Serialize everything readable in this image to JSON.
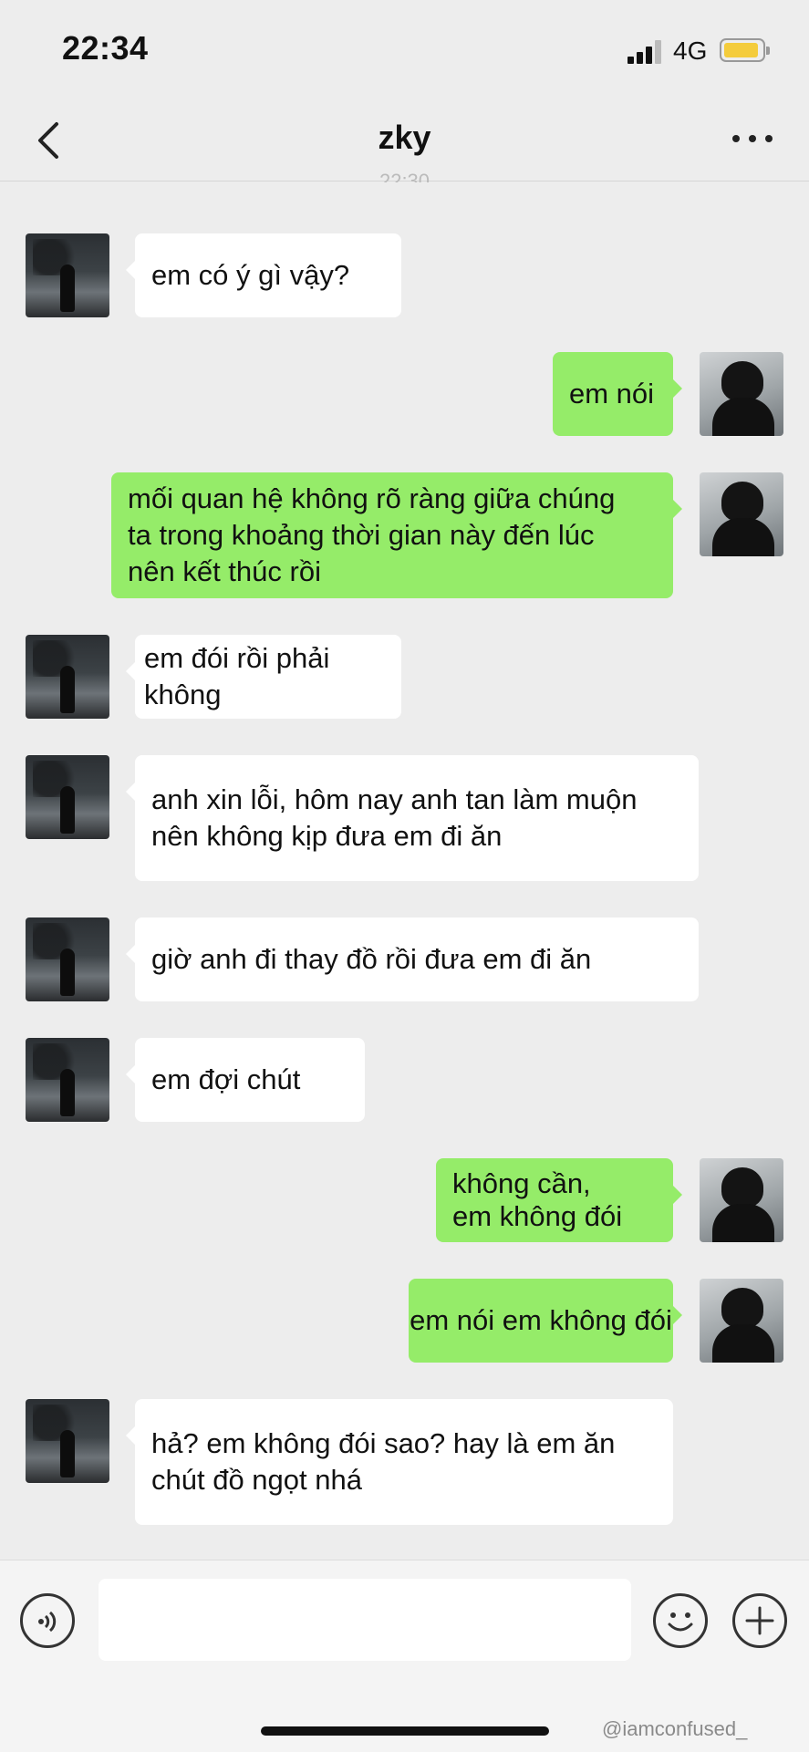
{
  "status_bar": {
    "time": "22:34",
    "network": "4G"
  },
  "nav": {
    "title": "zky",
    "timestamp_peek": "22:30"
  },
  "messages": [
    {
      "from": "him",
      "text": "em có ý gì vậy?"
    },
    {
      "from": "her",
      "text": "em nói"
    },
    {
      "from": "her",
      "text": "mối quan hệ không rõ ràng giữa chúng\nta trong khoảng thời gian này đến lúc\nnên kết thúc rồi"
    },
    {
      "from": "him",
      "text": "em đói rồi phải không"
    },
    {
      "from": "him",
      "text": "anh xin lỗi, hôm nay anh tan làm muộn\nnên không kịp đưa em đi ăn"
    },
    {
      "from": "him",
      "text": "giờ anh đi thay đồ rồi đưa em đi ăn"
    },
    {
      "from": "him",
      "text": "em đợi chút"
    },
    {
      "from": "her",
      "text": "không cần,\nem không đói"
    },
    {
      "from": "her",
      "text": "em nói em không đói"
    },
    {
      "from": "him",
      "text": "hả? em không đói sao? hay là em ăn\nchút đồ ngọt nhá"
    }
  ],
  "input": {
    "placeholder": ""
  },
  "watermark": "@iamconfused_",
  "colors": {
    "background": "#ededed",
    "bubble_sent": "#95ec69",
    "bubble_received": "#ffffff",
    "battery": "#f4cc3c"
  },
  "icons": [
    "back-chevron-icon",
    "more-dots-icon",
    "voice-icon",
    "emoji-icon",
    "plus-icon"
  ]
}
